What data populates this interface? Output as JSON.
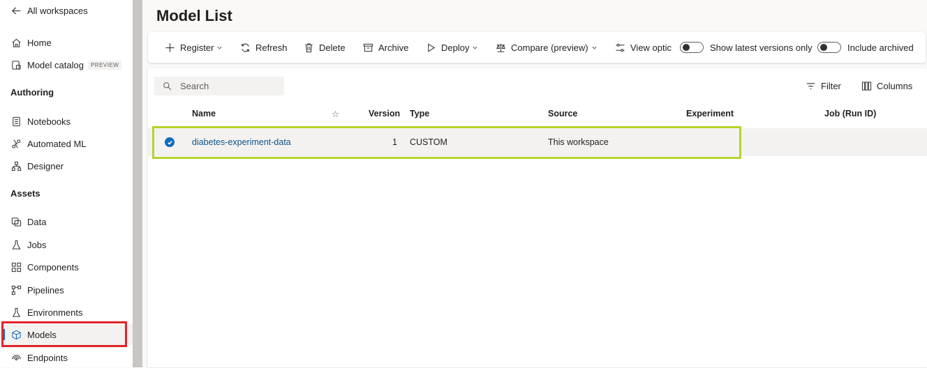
{
  "sidebar": {
    "back_link": "All workspaces",
    "items_top": [
      {
        "label": "Home",
        "icon": "home-icon"
      },
      {
        "label": "Model catalog",
        "badge": "PREVIEW",
        "icon": "catalog-icon"
      }
    ],
    "sections": [
      {
        "title": "Authoring",
        "items": [
          {
            "label": "Notebooks",
            "icon": "notebook-icon"
          },
          {
            "label": "Automated ML",
            "icon": "automl-icon"
          },
          {
            "label": "Designer",
            "icon": "designer-icon"
          }
        ]
      },
      {
        "title": "Assets",
        "items": [
          {
            "label": "Data",
            "icon": "data-icon"
          },
          {
            "label": "Jobs",
            "icon": "flask-icon"
          },
          {
            "label": "Components",
            "icon": "components-icon"
          },
          {
            "label": "Pipelines",
            "icon": "pipeline-icon"
          },
          {
            "label": "Environments",
            "icon": "environment-icon"
          },
          {
            "label": "Models",
            "icon": "cube-icon",
            "active": true
          },
          {
            "label": "Endpoints",
            "icon": "endpoint-icon"
          }
        ]
      }
    ]
  },
  "main": {
    "title": "Model List",
    "toolbar": {
      "register": "Register",
      "refresh": "Refresh",
      "delete": "Delete",
      "archive": "Archive",
      "deploy": "Deploy",
      "compare": "Compare (preview)",
      "view_options": "View optic",
      "toggle_latest": "Show latest versions only",
      "toggle_archived": "Include archived"
    },
    "search_placeholder": "Search",
    "filter": "Filter",
    "columns": "Columns",
    "table": {
      "headers": [
        "Name",
        "Version",
        "Type",
        "Source",
        "Experiment",
        "Job (Run ID)"
      ],
      "rows": [
        {
          "name": "diabetes-experiment-data",
          "version": "1",
          "type": "CUSTOM",
          "source": "This workspace",
          "experiment": "",
          "job": "",
          "selected": true
        }
      ]
    }
  },
  "colors": {
    "accent": "#0f6cbd",
    "highlight_red": "#e3242b",
    "highlight_green": "#b5d32a"
  }
}
